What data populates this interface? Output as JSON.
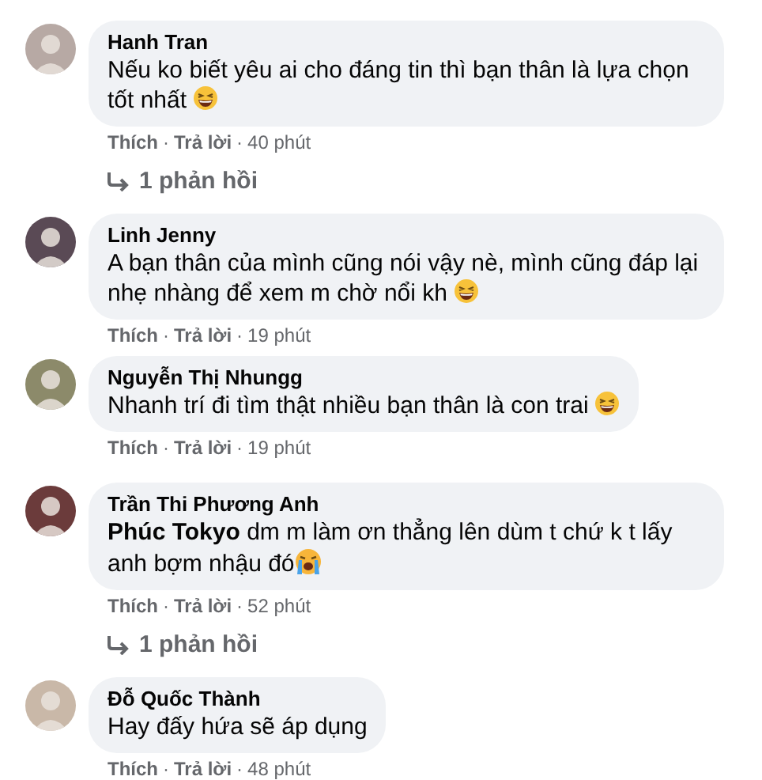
{
  "comments": [
    {
      "author": "Hanh Tran",
      "text": "Nếu ko biết yêu ai cho đáng tin thì bạn thân là lựa chọn tốt nhất",
      "emoji": {
        "kind": "laugh"
      },
      "like": "Thích",
      "sep_1": "·",
      "reply": "Trả lời",
      "sep_2": "·",
      "time": "40 phút",
      "replies": "1 phản hồi"
    },
    {
      "author": "Linh Jenny",
      "text": "A bạn thân của mình cũng nói vậy nè, mình cũng đáp lại nhẹ nhàng để xem m chờ nổi kh",
      "emoji": {
        "kind": "laugh"
      },
      "like": "Thích",
      "sep_1": "·",
      "reply": "Trả lời",
      "sep_2": "·",
      "time": "19 phút"
    },
    {
      "author": "Nguyễn Thị Nhungg",
      "text": "Nhanh trí đi tìm thật nhiều bạn thân là con trai",
      "emoji": {
        "kind": "laugh"
      },
      "like": "Thích",
      "sep_1": "·",
      "reply": "Trả lời",
      "sep_2": "·",
      "time": "19 phút"
    },
    {
      "author": "Trần Thi Phương Anh",
      "text": "**Phúc Tokyo** dm m làm ơn thẳng lên dùm t chứ k t lấy anh bợm nhậu đó",
      "emoji": {
        "kind": "cry"
      },
      "like": "Thích",
      "sep_1": "·",
      "reply": "Trả lời",
      "sep_2": "·",
      "time": "52 phút",
      "replies": "1 phản hồi"
    },
    {
      "author": "Đỗ Quốc Thành",
      "text": "Hay đấy hứa sẽ áp dụng",
      "like": "Thích",
      "sep_1": "·",
      "reply": "Trả lời",
      "sep_2": "·",
      "time": "48 phút"
    }
  ]
}
